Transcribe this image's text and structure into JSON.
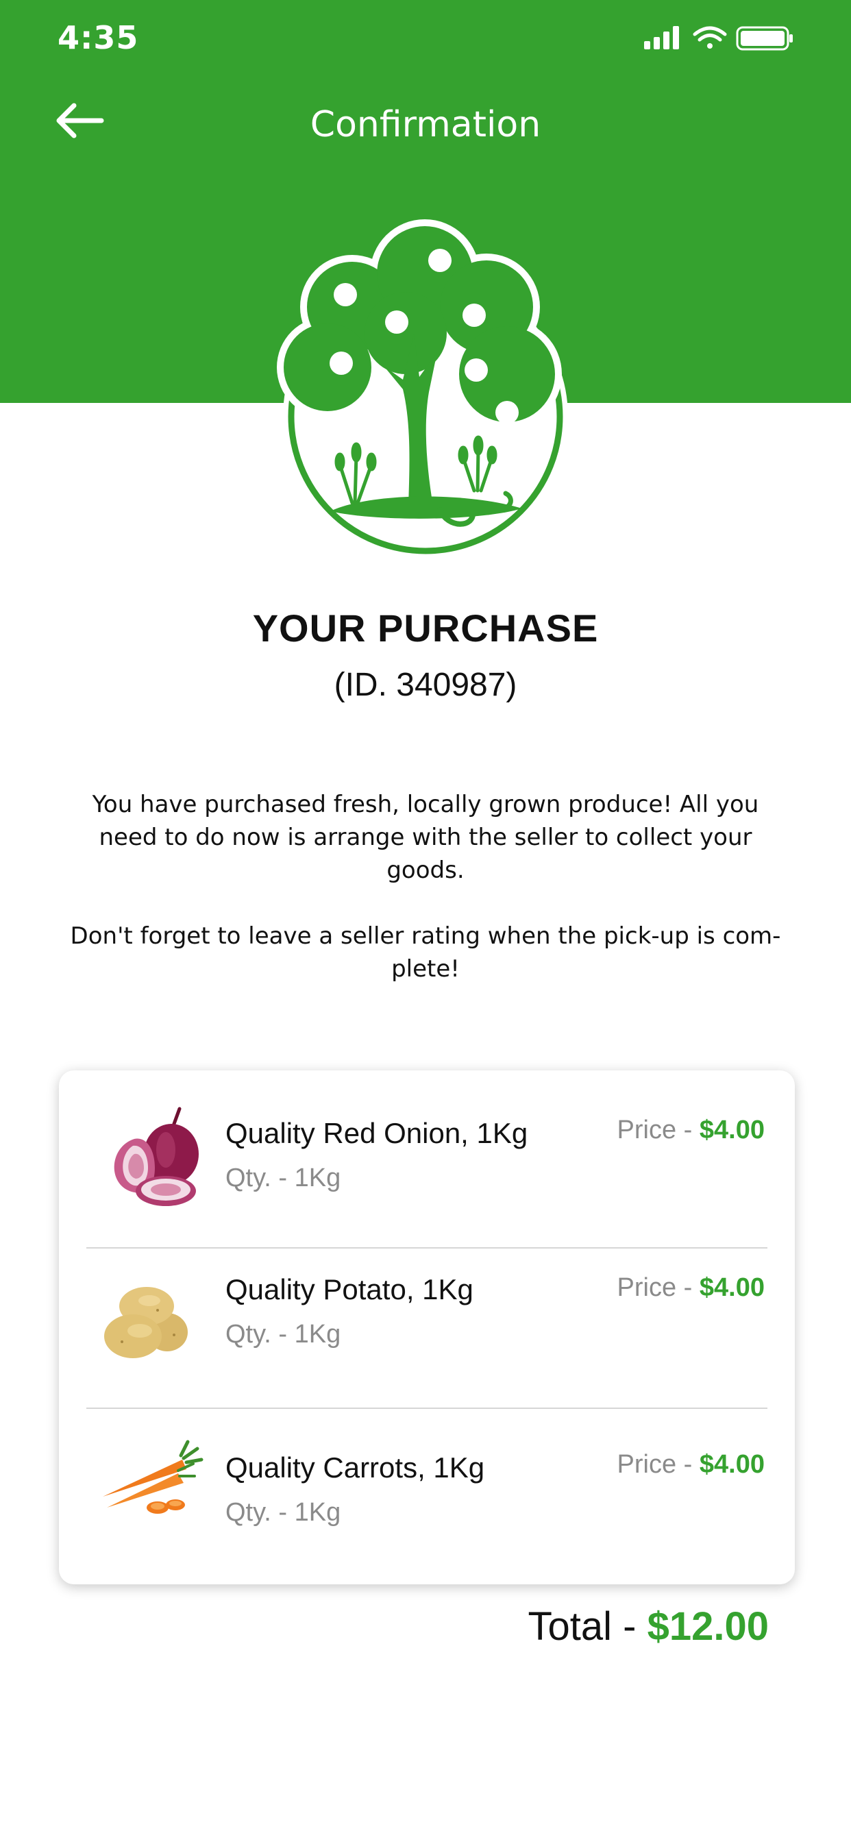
{
  "status_bar": {
    "time": "4:35"
  },
  "header": {
    "title": "Confirmation"
  },
  "purchase": {
    "title": "YOUR PURCHASE",
    "id_text": "(ID. 340987)"
  },
  "message": {
    "paragraph1": "You have purchased fresh, locally grown produce! All you need to do now is arrange with the seller to collect your goods.",
    "paragraph2": "Don't forget to leave a seller rating when the pick-up is com-plete!"
  },
  "items": [
    {
      "name": "Quality Red Onion, 1Kg",
      "qty": "Qty. - 1Kg",
      "price_label": "Price - ",
      "price": "$4.00",
      "icon": "red-onion-image"
    },
    {
      "name": "Quality Potato, 1Kg",
      "qty": "Qty. - 1Kg",
      "price_label": "Price - ",
      "price": "$4.00",
      "icon": "potato-image"
    },
    {
      "name": "Quality Carrots, 1Kg",
      "qty": "Qty. - 1Kg",
      "price_label": "Price - ",
      "price": "$4.00",
      "icon": "carrot-image"
    }
  ],
  "total": {
    "label": "Total - ",
    "amount": "$12.00"
  },
  "colors": {
    "brand_green": "#35a22f",
    "muted_text": "#8a8a8a",
    "text": "#111111"
  }
}
